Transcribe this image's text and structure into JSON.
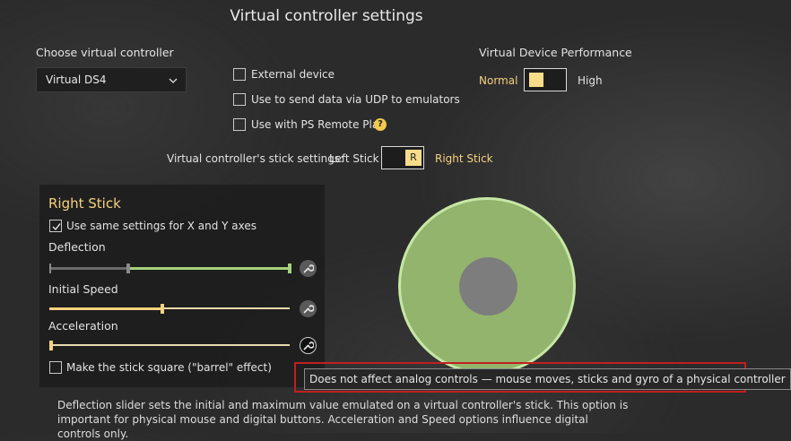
{
  "header": {
    "title": "Virtual controller settings"
  },
  "controller": {
    "label": "Choose virtual controller",
    "selected": "Virtual DS4"
  },
  "options": {
    "external_device": "External device",
    "udp": "Use to send data via UDP to emulators",
    "ps_remote_play": "Use with PS Remote Play",
    "help_glyph": "?"
  },
  "performance": {
    "title": "Virtual Device Performance",
    "normal": "Normal",
    "high": "High"
  },
  "stick_settings": {
    "label": "Virtual controller's stick settings:",
    "left": "Left Stick",
    "toggle_letter": "R",
    "right": "Right Stick"
  },
  "panel": {
    "title": "Right Stick",
    "same_axes": "Use same settings for X and Y axes",
    "deflection": {
      "label": "Deflection",
      "min": 0.33,
      "max": 1.0
    },
    "initial_speed": {
      "label": "Initial Speed",
      "value": 0.47
    },
    "acceleration": {
      "label": "Acceleration",
      "value": 0.0
    },
    "square": "Make the stick square (\"barrel\" effect)"
  },
  "tooltip": "Does not affect analog controls — mouse moves, sticks and gyro of a physical controller",
  "description": {
    "line1": "Deflection slider sets the initial and maximum value emulated on a virtual controller's stick. This option is",
    "line2": "important for physical mouse and digital buttons. Acceleration and Speed options influence digital controls only."
  },
  "colors": {
    "accent": "#f4d27f",
    "stick_fill": "#92b46d",
    "stick_ring": "#c6e7a5",
    "highlight_box": "#c0201e"
  }
}
